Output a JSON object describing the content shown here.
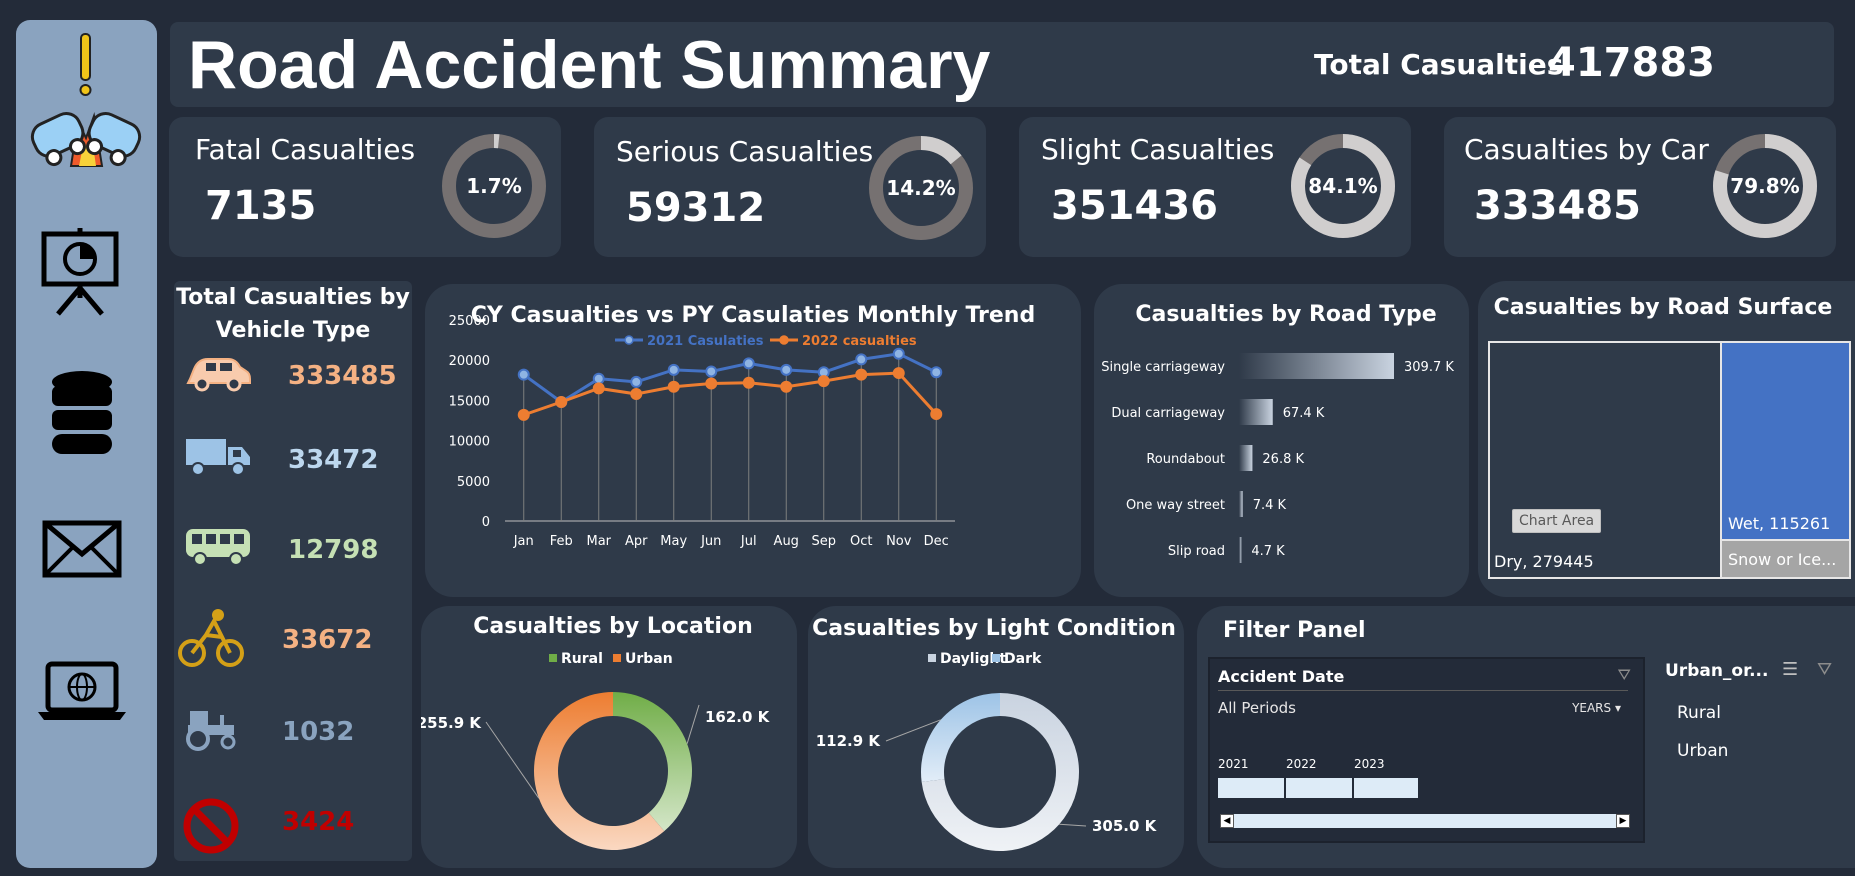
{
  "header": {
    "title": "Road Accident Summary",
    "total_label": "Total Casualties",
    "total_value": "417883"
  },
  "sidebar": {
    "icons": [
      "accident-icon",
      "presentation-chart-icon",
      "database-icon",
      "mail-icon",
      "laptop-globe-icon"
    ]
  },
  "kpis": [
    {
      "title": "Fatal Casualties",
      "value": "7135",
      "pct_label": "1.7%",
      "pct": 0.017
    },
    {
      "title": "Serious Casualties",
      "value": "59312",
      "pct_label": "14.2%",
      "pct": 0.142
    },
    {
      "title": "Slight Casualties",
      "value": "351436",
      "pct_label": "84.1%",
      "pct": 0.841
    },
    {
      "title": "Casualties by Car",
      "value": "333485",
      "pct_label": "79.8%",
      "pct": 0.798
    }
  ],
  "vehicle_panel": {
    "title_line1": "Total Casualties by",
    "title_line2": "Vehicle Type",
    "items": [
      {
        "icon": "car-icon",
        "value": "333485",
        "color": "#f4b183"
      },
      {
        "icon": "truck-icon",
        "value": "33472",
        "color": "#bdd7ee"
      },
      {
        "icon": "bus-icon",
        "value": "12798",
        "color": "#c5e0b4"
      },
      {
        "icon": "bicycle-icon",
        "value": "33672",
        "color": "#f4b183"
      },
      {
        "icon": "tractor-icon",
        "value": "1032",
        "color": "#8aa3bf"
      },
      {
        "icon": "no-entry-icon",
        "value": "3424",
        "color": "#c00000"
      }
    ]
  },
  "chart_data": [
    {
      "type": "line",
      "title": "CY Casualties vs PY Casulaties Monthly Trend",
      "categories": [
        "Jan",
        "Feb",
        "Mar",
        "Apr",
        "May",
        "Jun",
        "Jul",
        "Aug",
        "Sep",
        "Oct",
        "Nov",
        "Dec"
      ],
      "yticks": [
        "25000",
        "20000",
        "15000",
        "10000",
        "5000",
        "0"
      ],
      "ylim": [
        0,
        25000
      ],
      "grid": false,
      "legend": "top",
      "series": [
        {
          "name": "2021 Casulaties",
          "color": "#4472c4",
          "values": [
            18200,
            14800,
            17700,
            17300,
            18800,
            18600,
            19600,
            18800,
            18500,
            20100,
            20800,
            18500
          ]
        },
        {
          "name": "2022 casualties",
          "color": "#ed7d31",
          "values": [
            13200,
            14800,
            16500,
            15800,
            16700,
            17100,
            17200,
            16700,
            17400,
            18200,
            18400,
            13300
          ]
        }
      ]
    },
    {
      "type": "bar",
      "title": "Casualties by Road Type",
      "categories": [
        "Single carriageway",
        "Dual carriageway",
        "Roundabout",
        "One way street",
        "Slip road"
      ],
      "values": [
        309.7,
        67.4,
        26.8,
        7.4,
        4.7
      ],
      "value_labels": [
        "309.7 K",
        "67.4 K",
        "26.8 K",
        "7.4 K",
        "4.7 K"
      ]
    },
    {
      "type": "treemap",
      "title": "Casualties by Road Surface",
      "labels": [
        "Dry, 279445",
        "Wet, 115261",
        "Snow or Ice..."
      ],
      "values": [
        279445,
        115261,
        23177
      ],
      "tooltip": "Chart Area"
    },
    {
      "type": "pie",
      "title": "Casualties by Location",
      "legend": "top",
      "series": [
        {
          "name": "Rural",
          "value": 162.0,
          "label": "162.0 K",
          "color": "#70ad47"
        },
        {
          "name": "Urban",
          "value": 255.9,
          "label": "255.9 K",
          "color": "#ed7d31"
        }
      ]
    },
    {
      "type": "pie",
      "title": "Casualties by Light Condition",
      "legend": "top",
      "series": [
        {
          "name": "Daylight",
          "value": 305.0,
          "label": "305.0 K",
          "color": "#c9d3e0"
        },
        {
          "name": "Dark",
          "value": 112.9,
          "label": "112.9 K",
          "color": "#9dc3e6"
        }
      ]
    }
  ],
  "filter_panel": {
    "title": "Filter Panel",
    "timeline": {
      "header": "Accident Date",
      "period": "All Periods",
      "level": "YEARS",
      "years": [
        "2021",
        "2022",
        "2023"
      ]
    },
    "slicer": {
      "header": "Urban_or...",
      "items": [
        "Rural",
        "Urban"
      ]
    }
  }
}
